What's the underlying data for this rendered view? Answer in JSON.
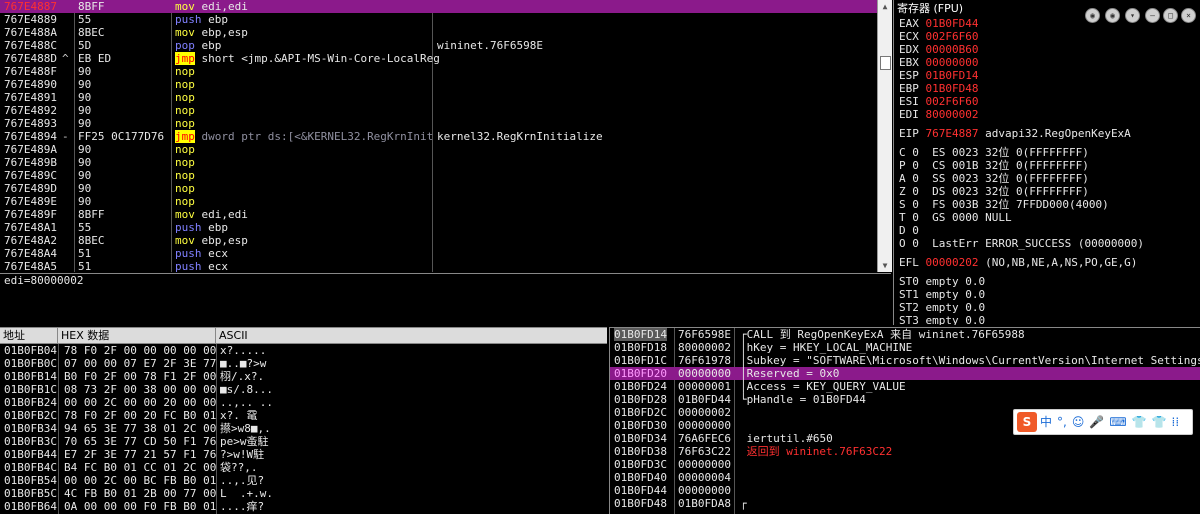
{
  "disasm": {
    "rows": [
      {
        "addr": "767E4887",
        "mark": "",
        "hex": "8BFF",
        "mn": "mov",
        "mn_class": "m-mov",
        "ops": "edi,edi",
        "cmt": "",
        "selected": true
      },
      {
        "addr": "767E4889",
        "mark": "",
        "hex": "55",
        "mn": "push",
        "mn_class": "m-push",
        "ops": "ebp",
        "cmt": ""
      },
      {
        "addr": "767E488A",
        "mark": "",
        "hex": "8BEC",
        "mn": "mov",
        "mn_class": "m-mov",
        "ops": "ebp,esp",
        "cmt": ""
      },
      {
        "addr": "767E488C",
        "mark": "",
        "hex": "5D",
        "mn": "pop",
        "mn_class": "m-pop",
        "ops": "ebp",
        "cmt": "wininet.76F6598E"
      },
      {
        "addr": "767E488D",
        "mark": "^",
        "hex": "EB ED",
        "mn": "jmp",
        "mn_class": "m-jmp",
        "ops": "short <jmp.&API-MS-Win-Core-LocalReg",
        "cmt": ""
      },
      {
        "addr": "767E488F",
        "mark": "",
        "hex": "90",
        "mn": "nop",
        "mn_class": "m-nop",
        "ops": "",
        "cmt": ""
      },
      {
        "addr": "767E4890",
        "mark": "",
        "hex": "90",
        "mn": "nop",
        "mn_class": "m-nop",
        "ops": "",
        "cmt": ""
      },
      {
        "addr": "767E4891",
        "mark": "",
        "hex": "90",
        "mn": "nop",
        "mn_class": "m-nop",
        "ops": "",
        "cmt": ""
      },
      {
        "addr": "767E4892",
        "mark": "",
        "hex": "90",
        "mn": "nop",
        "mn_class": "m-nop",
        "ops": "",
        "cmt": ""
      },
      {
        "addr": "767E4893",
        "mark": "",
        "hex": "90",
        "mn": "nop",
        "mn_class": "m-nop",
        "ops": "",
        "cmt": ""
      },
      {
        "addr": "767E4894",
        "mark": "-",
        "hex": "FF25 0C177D76",
        "mn": "jmp",
        "mn_class": "m-jmp",
        "ops": "dword ptr ds:[<&KERNEL32.RegKrnInit",
        "cmt": "kernel32.RegKrnInitialize",
        "gray": true
      },
      {
        "addr": "767E489A",
        "mark": "",
        "hex": "90",
        "mn": "nop",
        "mn_class": "m-nop",
        "ops": "",
        "cmt": ""
      },
      {
        "addr": "767E489B",
        "mark": "",
        "hex": "90",
        "mn": "nop",
        "mn_class": "m-nop",
        "ops": "",
        "cmt": ""
      },
      {
        "addr": "767E489C",
        "mark": "",
        "hex": "90",
        "mn": "nop",
        "mn_class": "m-nop",
        "ops": "",
        "cmt": ""
      },
      {
        "addr": "767E489D",
        "mark": "",
        "hex": "90",
        "mn": "nop",
        "mn_class": "m-nop",
        "ops": "",
        "cmt": ""
      },
      {
        "addr": "767E489E",
        "mark": "",
        "hex": "90",
        "mn": "nop",
        "mn_class": "m-nop",
        "ops": "",
        "cmt": ""
      },
      {
        "addr": "767E489F",
        "mark": "",
        "hex": "8BFF",
        "mn": "mov",
        "mn_class": "m-mov",
        "ops": "edi,edi",
        "cmt": ""
      },
      {
        "addr": "767E48A1",
        "mark": "",
        "hex": "55",
        "mn": "push",
        "mn_class": "m-push",
        "ops": "ebp",
        "cmt": ""
      },
      {
        "addr": "767E48A2",
        "mark": "",
        "hex": "8BEC",
        "mn": "mov",
        "mn_class": "m-mov",
        "ops": "ebp,esp",
        "cmt": ""
      },
      {
        "addr": "767E48A4",
        "mark": "",
        "hex": "51",
        "mn": "push",
        "mn_class": "m-push",
        "ops": "ecx",
        "cmt": ""
      },
      {
        "addr": "767E48A5",
        "mark": "",
        "hex": "51",
        "mn": "push",
        "mn_class": "m-push",
        "ops": "ecx",
        "cmt": ""
      }
    ]
  },
  "info": {
    "line": "edi=80000002"
  },
  "registers": {
    "title": "寄存器 (FPU)",
    "gpr": [
      {
        "name": "EAX",
        "value": "01B0FD44",
        "rest": ""
      },
      {
        "name": "ECX",
        "value": "002F6F60",
        "rest": ""
      },
      {
        "name": "EDX",
        "value": "00000B60",
        "rest": ""
      },
      {
        "name": "EBX",
        "value": "00000000",
        "rest": ""
      },
      {
        "name": "ESP",
        "value": "01B0FD14",
        "rest": ""
      },
      {
        "name": "EBP",
        "value": "01B0FD48",
        "rest": ""
      },
      {
        "name": "ESI",
        "value": "002F6F60",
        "rest": ""
      },
      {
        "name": "EDI",
        "value": "80000002",
        "rest": ""
      }
    ],
    "eip": {
      "name": "EIP",
      "value": "767E4887",
      "rest": "advapi32.RegOpenKeyExA"
    },
    "flags": [
      {
        "f": "C 0",
        "s": "ES 0023 32位 0(FFFFFFFF)"
      },
      {
        "f": "P 0",
        "s": "CS 001B 32位 0(FFFFFFFF)",
        "red": true
      },
      {
        "f": "A 0",
        "s": "SS 0023 32位 0(FFFFFFFF)"
      },
      {
        "f": "Z 0",
        "s": "DS 0023 32位 0(FFFFFFFF)"
      },
      {
        "f": "S 0",
        "s": "FS 003B 32位 7FFDD000(4000)"
      },
      {
        "f": "T 0",
        "s": "GS 0000 NULL"
      },
      {
        "f": "D 0",
        "s": ""
      },
      {
        "f": "O 0",
        "s": "LastErr ERROR_SUCCESS (00000000)"
      }
    ],
    "efl": {
      "name": "EFL",
      "value": "00000202",
      "rest": "(NO,NB,NE,A,NS,PO,GE,G)"
    },
    "fpu": [
      "ST0 empty 0.0",
      "ST1 empty 0.0",
      "ST2 empty 0.0",
      "ST3 empty 0.0"
    ]
  },
  "dump": {
    "headers": {
      "addr": "地址",
      "hex": "HEX 数据",
      "ascii": "ASCII"
    },
    "rows": [
      {
        "a": "01B0FB04",
        "h": "78 F0 2F 00 00 00 00 00",
        "s": "x?....."
      },
      {
        "a": "01B0FB0C",
        "h": "07 00 00 07 E7 2F 3E 77",
        "s": "■..■?>w"
      },
      {
        "a": "01B0FB14",
        "h": "B0 F0 2F 00 78 F1 2F 00",
        "s": "栩/.x?."
      },
      {
        "a": "01B0FB1C",
        "h": "08 73 2F 00 38 00 00 00",
        "s": "■s/.8..."
      },
      {
        "a": "01B0FB24",
        "h": "00 00 2C 00 00 20 00 00",
        "s": "..,.. .."
      },
      {
        "a": "01B0FB2C",
        "h": "78 F0 2F 00 20 FC B0 01",
        "s": "x?. 鼋"
      },
      {
        "a": "01B0FB34",
        "h": "94 65 3E 77 38 01 2C 00",
        "s": "攃>w8■,."
      },
      {
        "a": "01B0FB3C",
        "h": "70 65 3E 77 CD 50 F1 76",
        "s": "pe>w蚉駐"
      },
      {
        "a": "01B0FB44",
        "h": "E7 2F 3E 77 21 57 F1 76",
        "s": "?>w!W駐"
      },
      {
        "a": "01B0FB4C",
        "h": "B4 FC B0 01 CC 01 2C 00",
        "s": "袋??,."
      },
      {
        "a": "01B0FB54",
        "h": "00 00 2C 00 BC FB B0 01",
        "s": "..,.见?"
      },
      {
        "a": "01B0FB5C",
        "h": "4C FB B0 01 2B 00 77 00",
        "s": "L  .+.w."
      },
      {
        "a": "01B0FB64",
        "h": "0A 00 00 00 F0 FB B0 01",
        "s": "....痒?"
      }
    ]
  },
  "stack": {
    "rows": [
      {
        "a": "01B0FD14",
        "v": "76F6598E",
        "c": "CALL 到 RegOpenKeyExA 来自 wininet.76F65988",
        "bracket": "top",
        "hl": true
      },
      {
        "a": "01B0FD18",
        "v": "80000002",
        "c": "hKey = HKEY_LOCAL_MACHINE",
        "bracket": "mid"
      },
      {
        "a": "01B0FD1C",
        "v": "76F61978",
        "c": "Subkey = \"SOFTWARE\\Microsoft\\Windows\\CurrentVersion\\Internet Settings\"",
        "bracket": "mid"
      },
      {
        "a": "01B0FD20",
        "v": "00000000",
        "c": "Reserved = 0x0",
        "bracket": "mid",
        "selected": true
      },
      {
        "a": "01B0FD24",
        "v": "00000001",
        "c": "Access = KEY_QUERY_VALUE",
        "bracket": "mid"
      },
      {
        "a": "01B0FD28",
        "v": "01B0FD44",
        "c": "pHandle = 01B0FD44",
        "bracket": "bot"
      },
      {
        "a": "01B0FD2C",
        "v": "00000002",
        "c": "",
        "bracket": ""
      },
      {
        "a": "01B0FD30",
        "v": "00000000",
        "c": "",
        "bracket": ""
      },
      {
        "a": "01B0FD34",
        "v": "76A6FEC6",
        "c": "iertutil.#650",
        "bracket": ""
      },
      {
        "a": "01B0FD38",
        "v": "76F63C22",
        "c": "返回到 wininet.76F63C22",
        "bracket": "",
        "red": true
      },
      {
        "a": "01B0FD3C",
        "v": "00000000",
        "c": "",
        "bracket": ""
      },
      {
        "a": "01B0FD40",
        "v": "00000004",
        "c": "",
        "bracket": ""
      },
      {
        "a": "01B0FD44",
        "v": "00000000",
        "c": "",
        "bracket": ""
      },
      {
        "a": "01B0FD48",
        "v": "01B0FDA8",
        "c": "",
        "bracket": "top"
      }
    ]
  },
  "ime": {
    "logo": "S",
    "items": [
      "中",
      "°,",
      "☺",
      "🎤",
      "⌨",
      "👕",
      "👕",
      "⁞⁞"
    ]
  }
}
